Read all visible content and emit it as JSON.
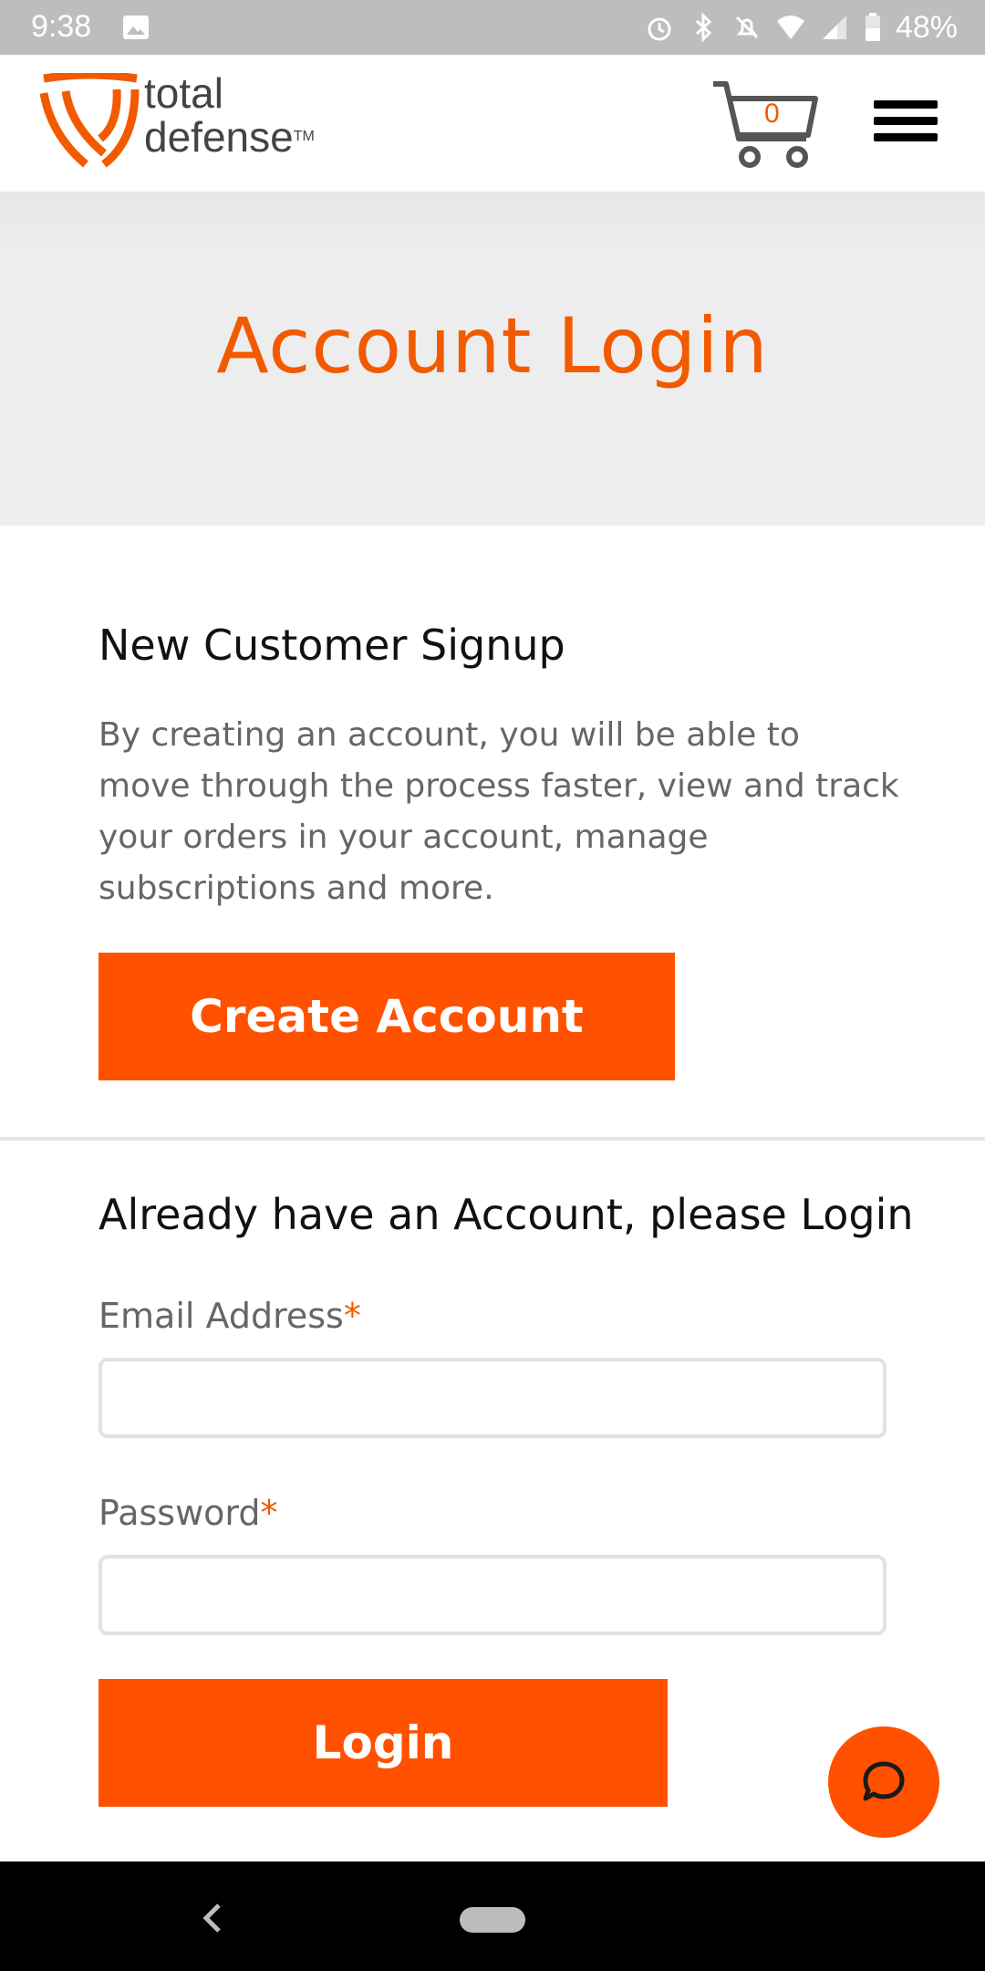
{
  "status_bar": {
    "time": "9:38",
    "battery": "48%",
    "icons": [
      "image-icon",
      "alarm-icon",
      "bluetooth-icon",
      "mute-icon",
      "wifi-icon",
      "signal-icon",
      "battery-icon"
    ]
  },
  "header": {
    "logo_line1": "total",
    "logo_line2": "defense",
    "logo_tm": "TM",
    "cart_count": "0"
  },
  "hero": {
    "title": "Account Login"
  },
  "signup": {
    "title": "New Customer Signup",
    "description": "By creating an account, you will be able to move through the process faster, view and track your orders in your account, manage subscriptions and more.",
    "button_label": "Create Account"
  },
  "login": {
    "title": "Already have an Account, please Login",
    "email_label": "Email Address",
    "password_label": "Password",
    "required_marker": "*",
    "email_value": "",
    "password_value": "",
    "button_label": "Login"
  },
  "colors": {
    "accent": "#ff5100",
    "hero_bg": "#ededed",
    "status_bar": "#bdbdbd"
  }
}
